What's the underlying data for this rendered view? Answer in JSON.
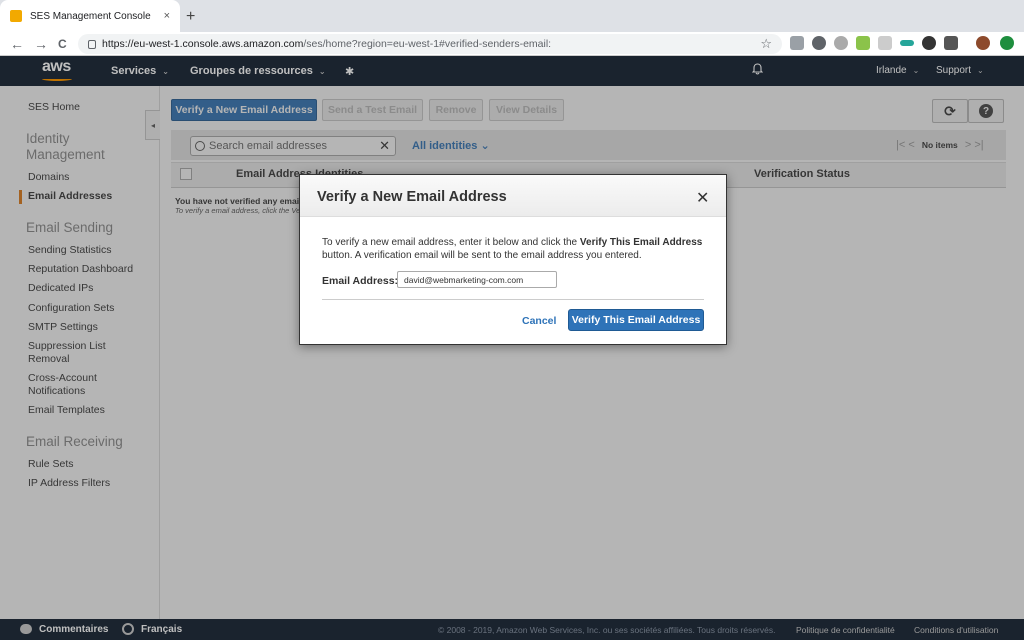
{
  "browser": {
    "tab_title": "SES Management Console",
    "tab_close": "×",
    "new_tab": "+",
    "url_host": "https://eu-west-1.console.aws.amazon.com",
    "url_path": "/ses/home?region=eu-west-1#verified-senders-email:",
    "back": "←",
    "forward": "→",
    "reload": "C",
    "bookmark": "☆"
  },
  "aws": {
    "logo": "aws",
    "services": "Services",
    "resource_groups": "Groupes de ressources",
    "pin": "✱",
    "bell": "🔔",
    "region": "Irlande",
    "support": "Support",
    "caret": "⌄"
  },
  "sidebar": {
    "home": "SES Home",
    "identity_head": "Identity Management",
    "domains": "Domains",
    "email_addresses": "Email Addresses",
    "sending_head": "Email Sending",
    "sending_items": [
      "Sending Statistics",
      "Reputation Dashboard",
      "Dedicated IPs",
      "Configuration Sets",
      "SMTP Settings",
      "Suppression List Removal",
      "Cross-Account Notifications",
      "Email Templates"
    ],
    "receiving_head": "Email Receiving",
    "receiving_items": [
      "Rule Sets",
      "IP Address Filters"
    ],
    "collapse": "◂"
  },
  "toolbar": {
    "verify_new": "Verify a New Email Address",
    "send_test": "Send a Test Email",
    "remove": "Remove",
    "view_details": "View Details",
    "refresh": "⟳",
    "help": "?"
  },
  "filter": {
    "search_placeholder": "Search email addresses",
    "clear": "✕",
    "all_identities": "All identities",
    "pager_first": "|<",
    "pager_prev": "<",
    "no_items": "No items",
    "pager_next": ">",
    "pager_last": ">|"
  },
  "table": {
    "col_email": "Email Address Identities",
    "col_status": "Verification Status",
    "empty_title": "You have not verified any email addresses.",
    "empty_sub": "To verify a email address, click the Verify a New Email Address button."
  },
  "modal": {
    "title": "Verify a New Email Address",
    "close": "✕",
    "desc_pre": "To verify a new email address, enter it below and click the ",
    "desc_bold": "Verify This Email Address",
    "desc_post": " button. A verification email will be sent to the email address you entered.",
    "label": "Email Address:",
    "value": "david@webmarketing-com.com",
    "cancel": "Cancel",
    "verify": "Verify This Email Address"
  },
  "footer": {
    "feedback": "Commentaires",
    "language": "Français",
    "copyright": "© 2008 - 2019, Amazon Web Services, Inc. ou ses sociétés affiliées. Tous droits réservés.",
    "privacy": "Politique de confidentialité",
    "terms": "Conditions d'utilisation"
  },
  "colors": {
    "aws_nav": "#232f3e",
    "aws_orange": "#ff9900",
    "primary_blue": "#2e73b8",
    "active_marker": "#e47911"
  }
}
